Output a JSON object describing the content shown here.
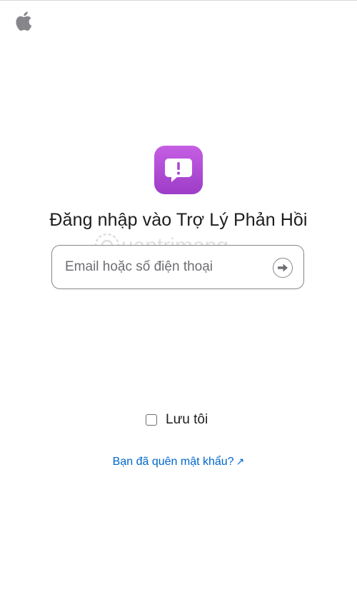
{
  "header": {
    "logo_icon": "apple-logo-icon"
  },
  "app": {
    "icon": "feedback-assistant-icon",
    "icon_color": "#b04ed8"
  },
  "login": {
    "title": "Đăng nhập vào Trợ Lý Phản Hồi",
    "email_placeholder": "Email hoặc số điện thoại",
    "email_value": "",
    "continue_icon": "arrow-right-circle-icon"
  },
  "remember_me": {
    "label": "Lưu tôi",
    "checked": false
  },
  "forgot_password": {
    "label": "Bạn đã quên mật khẩu?",
    "icon": "external-arrow-icon",
    "color": "#0066cc"
  },
  "watermark": {
    "text": "uantrimang",
    "icon": "quantrimang-logo-icon"
  }
}
